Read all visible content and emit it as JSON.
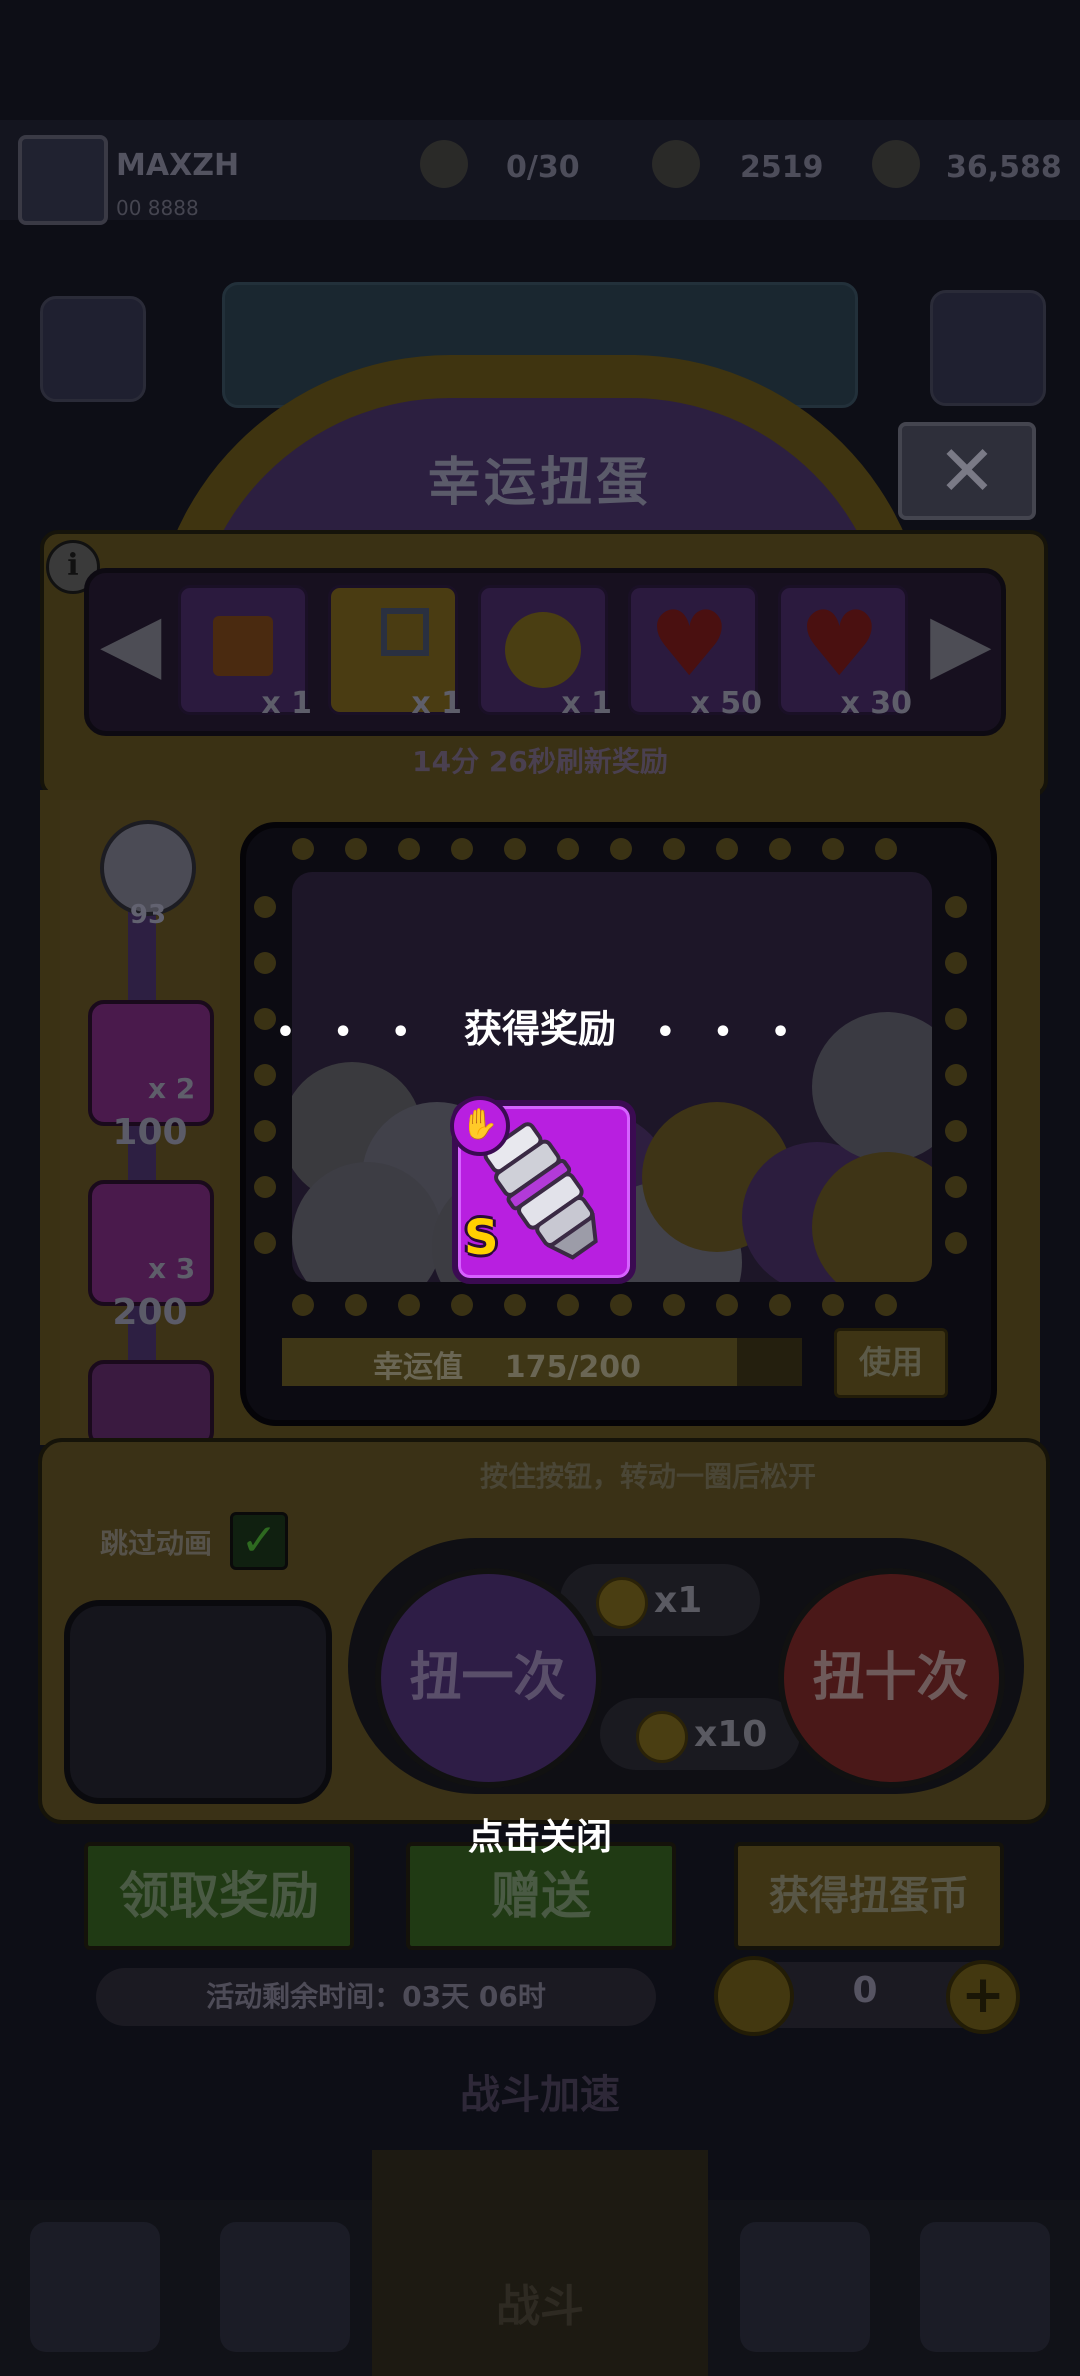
{
  "header": {
    "player_name": "MAXZH",
    "player_id": "00 8888",
    "stats": [
      "0/30",
      "2519",
      "36,588"
    ]
  },
  "machine": {
    "title": "幸运扭蛋",
    "close_icon": "close-icon",
    "info_label": "i",
    "rewards": [
      {
        "icon": "gift-box-icon",
        "count": "x 1"
      },
      {
        "icon": "key-icon",
        "count": "x 1"
      },
      {
        "icon": "gold-coin-icon",
        "count": "x 1"
      },
      {
        "icon": "heart-icon",
        "count": "x 50"
      },
      {
        "icon": "heart-icon",
        "count": "x 30"
      }
    ],
    "refresh_text": "14分 26秒刷新奖励",
    "progress": {
      "ball_value": "93",
      "milestones": [
        {
          "count": "x 2",
          "value": "100"
        },
        {
          "count": "x 3",
          "value": "200"
        }
      ]
    },
    "luck_label": "幸运值",
    "luck_value": "175/200",
    "luck_fraction": 0.875,
    "use_label": "使用"
  },
  "controls": {
    "hint": "按住按钮，转动一圈后松开",
    "skip_label": "跳过动画",
    "skip_checked": true,
    "spin_once": "扭一次",
    "spin_ten": "扭十次",
    "cost_once": "x1",
    "cost_ten": "x10"
  },
  "actions": {
    "claim": "领取奖励",
    "gift": "赠送",
    "get_coins": "获得扭蛋币",
    "remaining": "活动剩余时间：03天 06时",
    "coin_count": "0",
    "plus": "+"
  },
  "footer": {
    "battle_accel": "战斗加速",
    "battle": "战斗"
  },
  "overlay": {
    "dots": "• • •",
    "title": "获得奖励",
    "reward_grade": "S",
    "reward_icon": "armor-gauntlet-icon",
    "reward_type_icon": "glove-icon",
    "close_hint": "点击关闭"
  },
  "colors": {
    "overlay_text": "#ffffff",
    "reward_card": "#b81fe0",
    "grade": "#ffd000"
  }
}
